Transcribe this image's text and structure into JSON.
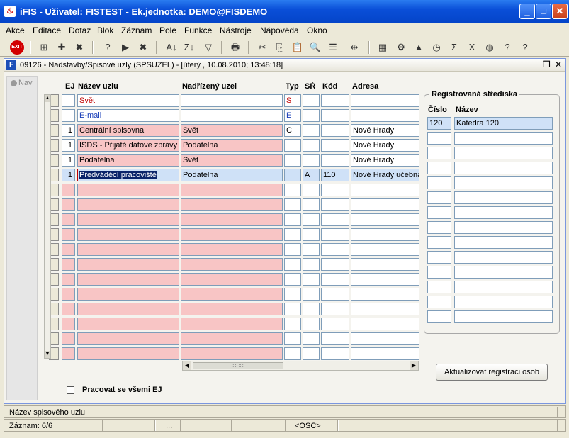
{
  "window": {
    "title": "iFIS - Uživatel: FISTEST - Ek.jednotka: DEMO@FISDEMO",
    "app_icon": "java-cup-icon"
  },
  "menu": [
    "Akce",
    "Editace",
    "Dotaz",
    "Blok",
    "Záznam",
    "Pole",
    "Funkce",
    "Nástroje",
    "Nápověda",
    "Okno"
  ],
  "toolbar": {
    "exit_label": "EXIT",
    "icons": [
      "exit-icon",
      "insert-record-icon",
      "save-icon",
      "delete-record-icon",
      "query-icon",
      "execute-query-icon",
      "cancel-query-icon",
      "sort-asc-icon",
      "sort-desc-icon",
      "filter-icon",
      "print-icon",
      "cut-icon",
      "copy-icon",
      "paste-icon",
      "find-icon",
      "list-icon",
      "split-icon",
      "calculator-icon",
      "settings-icon",
      "triangle-icon",
      "clock-icon",
      "sum-icon",
      "excel-icon",
      "globe-icon",
      "help-icon",
      "context-help-icon"
    ],
    "glyphs": [
      "⊕",
      "⊞",
      "✚",
      "✖",
      "?",
      "▶",
      "✖",
      "A↓",
      "Z↓",
      "▽",
      "🖶",
      "✂",
      "⎘",
      "📋",
      "🔍",
      "☰",
      "⇹",
      "▦",
      "⚙",
      "▲",
      "◷",
      "Σ",
      "X",
      "◍",
      "?",
      "?"
    ]
  },
  "form": {
    "title": "09126 - Nadstavby/Spisové uzly (SPSUZEL) - [úterý  , 10.08.2010; 13:48:18]",
    "nav_label": "Nav",
    "columns": {
      "ej": "EJ",
      "nazev": "Název uzlu",
      "nadrizeny": "Nadřízený uzel",
      "typ": "Typ",
      "sr": "SŘ",
      "kod": "Kód",
      "adresa": "Adresa"
    },
    "rows": [
      {
        "ej": "",
        "nazev": "Svět",
        "nadrizeny": "",
        "typ": "S",
        "sr": "",
        "kod": "",
        "adresa": ""
      },
      {
        "ej": "",
        "nazev": "E-mail",
        "nadrizeny": "",
        "typ": "E",
        "sr": "",
        "kod": "",
        "adresa": ""
      },
      {
        "ej": "1",
        "nazev": "Centrální spisovna",
        "nadrizeny": "Svět",
        "typ": "C",
        "sr": "",
        "kod": "",
        "adresa": "Nové Hrady"
      },
      {
        "ej": "1",
        "nazev": "ISDS - Přijaté datové zprávy",
        "nadrizeny": "Podatelna",
        "typ": "",
        "sr": "",
        "kod": "",
        "adresa": "Nové Hrady"
      },
      {
        "ej": "1",
        "nazev": "Podatelna",
        "nadrizeny": "Svět",
        "typ": "",
        "sr": "",
        "kod": "",
        "adresa": "Nové Hrady"
      },
      {
        "ej": "1",
        "nazev": "Předváděcí pracoviště",
        "nadrizeny": "Podatelna",
        "typ": "",
        "sr": "A",
        "kod": "110",
        "adresa": "Nové Hrady učebna"
      }
    ],
    "empty_rows": 12,
    "registrovana": {
      "title": "Registrovaná střediska",
      "col_cislo": "Číslo",
      "col_nazev": "Název",
      "rows": [
        {
          "cislo": "120",
          "nazev": "Katedra 120"
        }
      ],
      "empty_rows": 13
    },
    "button_label": "Aktualizovat registraci osob",
    "checkbox_label": "Pracovat se všemi EJ",
    "checkbox_checked": false
  },
  "status": {
    "field_hint": "Název spisového uzlu",
    "record": "Záznam: 6/6",
    "ellipsis": "...",
    "mode": "<OSC>"
  },
  "colors": {
    "pink_field": "#f8c5c5",
    "selected_row": "#cfe1f7",
    "title_blue": "#0a4fd8"
  }
}
